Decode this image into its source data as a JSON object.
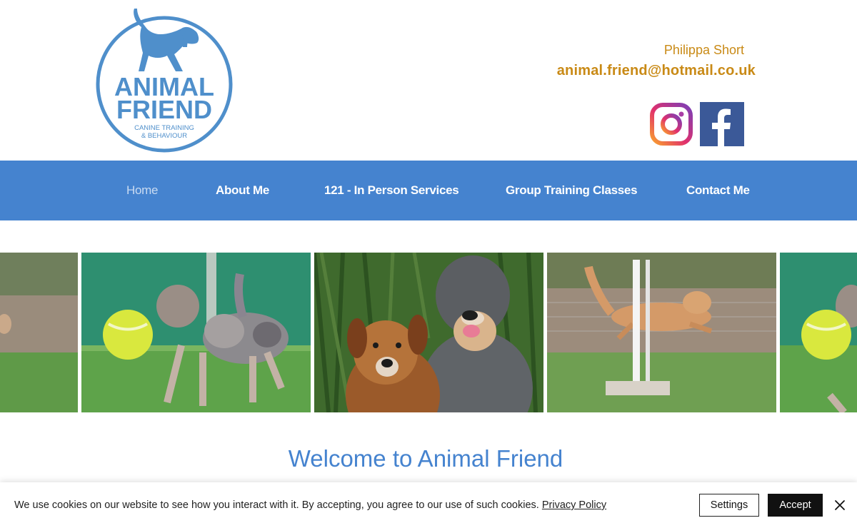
{
  "header": {
    "logo": {
      "title_line1": "ANIMAL",
      "title_line2": "FRIEND",
      "subtitle_line1": "CANINE TRAINING",
      "subtitle_line2": "& BEHAVIOUR",
      "icon": "dog-silhouette-icon",
      "color": "#4f8fcb"
    },
    "contact_name": "Philippa Short",
    "contact_email": "animal.friend@hotmail.co.uk",
    "accent_color": "#c98a16",
    "social": [
      {
        "name": "Instagram",
        "icon": "instagram-icon"
      },
      {
        "name": "Facebook",
        "icon": "facebook-icon"
      }
    ]
  },
  "nav": {
    "color": "#4583cf",
    "items": [
      {
        "label": "Home",
        "active": true
      },
      {
        "label": "About Me"
      },
      {
        "label": "121 - In Person Services"
      },
      {
        "label": "Group Training Classes"
      },
      {
        "label": "Contact Me"
      }
    ]
  },
  "gallery": {
    "slides": [
      {
        "subject": "dog with tennis ball"
      },
      {
        "subject": "merle dog carrying large tennis ball"
      },
      {
        "subject": "two dogs portrait"
      },
      {
        "subject": "dog jumping over agility pole"
      },
      {
        "subject": "dog with tennis ball"
      }
    ]
  },
  "main": {
    "welcome_heading": "Welcome to Animal Friend"
  },
  "cookie_banner": {
    "text": "We use cookies on our website to see how you interact with it. By accepting, you agree to our use of such cookies.",
    "policy_link": "Privacy Policy",
    "settings_label": "Settings",
    "accept_label": "Accept",
    "close_icon": "close-icon"
  }
}
